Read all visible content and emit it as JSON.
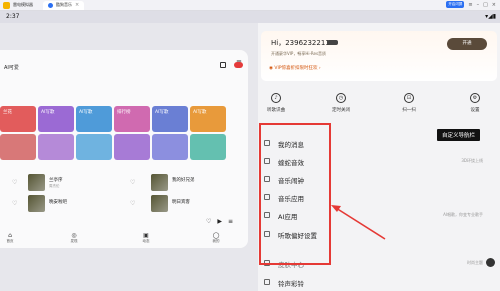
{
  "emulator": {
    "title": "雷电模拟器",
    "tab_label": "酷狗音乐",
    "badge": "开启闪屏"
  },
  "status_bar": {
    "time": "2:37",
    "icons": "▾◢▮"
  },
  "app": {
    "header_text": "AI可爱",
    "tiles": [
      "兰花",
      "AI写歌",
      "AI写歌",
      "排行榜",
      "AI写歌",
      "AI写歌"
    ],
    "songs": [
      {
        "title": "兰亭序",
        "subtitle": "周杰伦"
      },
      {
        "title": "我的好兄弟",
        "subtitle": ""
      },
      {
        "title": "晚安啦吧",
        "subtitle": ""
      },
      {
        "title": "明日宾客",
        "subtitle": ""
      }
    ],
    "tabs": [
      "首页",
      "发现",
      "动态",
      "我的"
    ]
  },
  "drawer": {
    "greeting": "Hi，2396232211",
    "vip_tip": "开通豪华VIP，畅享Hi-Res音质",
    "vip_button": "开通",
    "vip_banner": "VIP惊喜折扣限时狂欢",
    "quick_actions": [
      "听歌识曲",
      "定时关闭",
      "扫一扫",
      "设置"
    ],
    "tooltip": "自定义导航栏",
    "menu": [
      {
        "label": "我的消息",
        "note": ""
      },
      {
        "label": "蝰蛇音效",
        "note": "3D环绕上线"
      },
      {
        "label": "音乐闹钟",
        "note": ""
      },
      {
        "label": "音乐应用",
        "note": ""
      },
      {
        "label": "AI应用",
        "note": "AI唱歌，你变专业歌手"
      },
      {
        "label": "听歌偏好设置",
        "note": ""
      },
      {
        "label": "皮肤中心",
        "note": "时尚主题"
      },
      {
        "label": "铃声彩铃",
        "note": ""
      }
    ]
  },
  "colors": {
    "highlight": "#e53935",
    "vip_orange": "#d4560e"
  }
}
